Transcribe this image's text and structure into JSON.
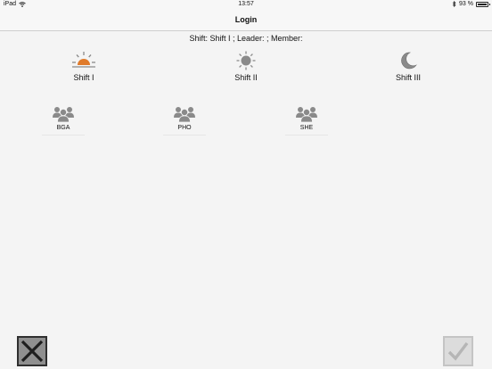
{
  "status_bar": {
    "device": "iPad",
    "time": "13:57",
    "battery_percent": "93 %",
    "battery_level": 0.93
  },
  "nav": {
    "title": "Login"
  },
  "summary": "Shift: Shift I ; Leader: ; Member:",
  "shifts": [
    {
      "label": "Shift I",
      "icon": "sunrise-icon",
      "color": "#e07b2b"
    },
    {
      "label": "Shift II",
      "icon": "sun-icon",
      "color": "#8a8a8a"
    },
    {
      "label": "Shift III",
      "icon": "moon-icon",
      "color": "#8a8a8a"
    }
  ],
  "departments": [
    {
      "label": "BGA",
      "icon": "group-icon"
    },
    {
      "label": "PHO",
      "icon": "group-icon"
    },
    {
      "label": "SHE",
      "icon": "group-icon"
    }
  ],
  "buttons": {
    "cancel_icon": "close-icon",
    "confirm_icon": "checkmark-icon"
  },
  "colors": {
    "accent_orange": "#e07b2b",
    "icon_gray": "#8a8a8a",
    "background": "#f4f4f4"
  }
}
